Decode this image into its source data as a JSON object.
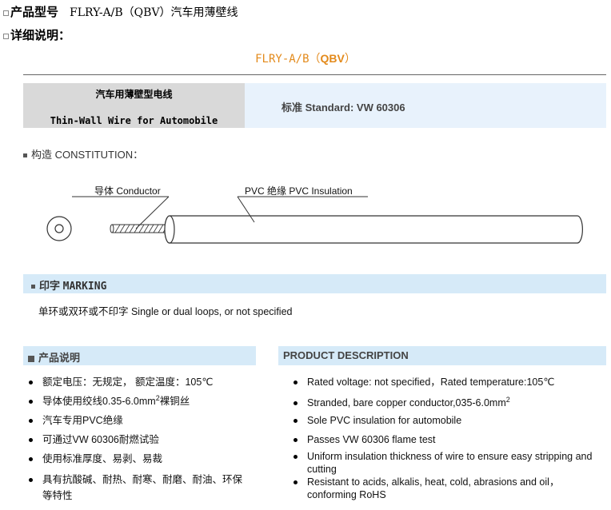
{
  "header": {
    "product_label": "产品型号",
    "product_model": "FLRY-A/B（QBV）汽车用薄壁线",
    "details_label": "详细说明："
  },
  "title": {
    "prefix": "FLRY-A/B（",
    "bold": "QBV",
    "suffix": "）"
  },
  "banner": {
    "cn_title": "汽车用薄壁型电线",
    "en_title": "Thin-Wall Wire for Automobile",
    "standard": "标准  Standard: VW 60306"
  },
  "construction": {
    "label": "构造  CONSTITUTION：",
    "conductor_label": "导体 Conductor",
    "insulation_label": "PVC 绝缘 PVC Insulation"
  },
  "marking": {
    "label_cn": "印字 ",
    "label_en": "MARKING",
    "text": "单环或双环或不印字  Single or dual loops, or not specified"
  },
  "description_cn": {
    "title": "产品说明",
    "items": [
      {
        "text": "额定电压：无规定，  额定温度：105℃"
      },
      {
        "text": "导体使用绞线0.35-6.0mm",
        "sup": "2",
        "after": "裸铜丝"
      },
      {
        "text": "汽车专用PVC绝缘"
      },
      {
        "text": "可通过VW 60306耐燃试验"
      },
      {
        "text": "使用标准厚度、易剥、易裁"
      },
      {
        "text": "具有抗酸碱、耐热、耐寒、耐磨、耐油、环保等特性"
      }
    ]
  },
  "description_en": {
    "title": "PRODUCT DESCRIPTION",
    "items": [
      {
        "text": "Rated voltage: not specified，Rated temperature:105℃"
      },
      {
        "text": "Stranded, bare copper conductor,035-6.0mm",
        "sup": "2",
        "after": ""
      },
      {
        "text": "Sole PVC insulation for automobile"
      },
      {
        "text": "Passes VW 60306 flame test"
      },
      {
        "text": "Uniform insulation thickness of wire to ensure easy stripping and cutting"
      },
      {
        "text": "Resistant to acids, alkalis, heat, cold, abrasions and oil，conforming RoHS"
      }
    ]
  },
  "colors": {
    "accent": "#e38a1b",
    "bar": "#d6eaf8",
    "banner_gray": "#d9d9d9",
    "banner_blue": "#e8f2fc"
  }
}
